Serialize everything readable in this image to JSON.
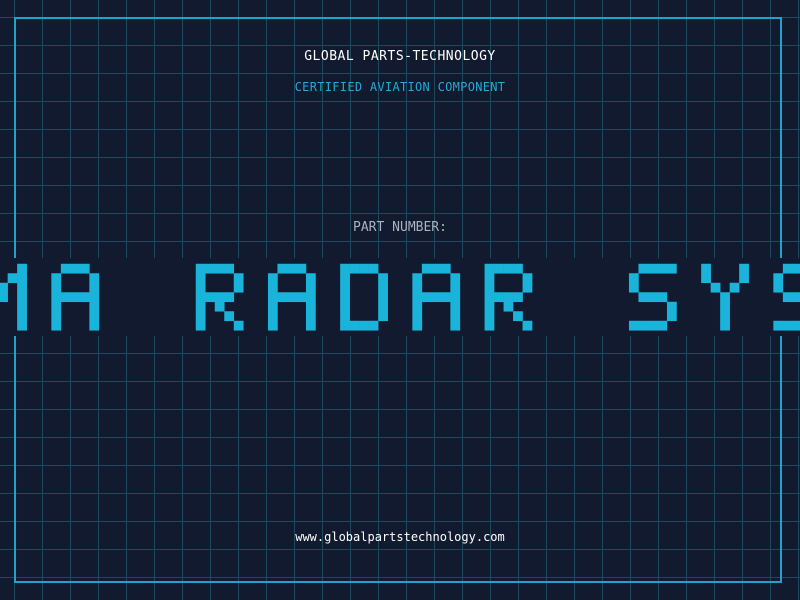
{
  "brand": "GLOBAL PARTS-TECHNOLOGY",
  "subtitle": "CERTIFIED AVIATION COMPONENT",
  "part_label": "PART NUMBER:",
  "part_name": "GAMMA RADAR SYSTEM",
  "website": "www.globalpartstechnology.com",
  "colors": {
    "background": "#111a2e",
    "grid": "#1f4a5e",
    "accent": "#1fa3c8",
    "headline": "#1ab3d9"
  }
}
